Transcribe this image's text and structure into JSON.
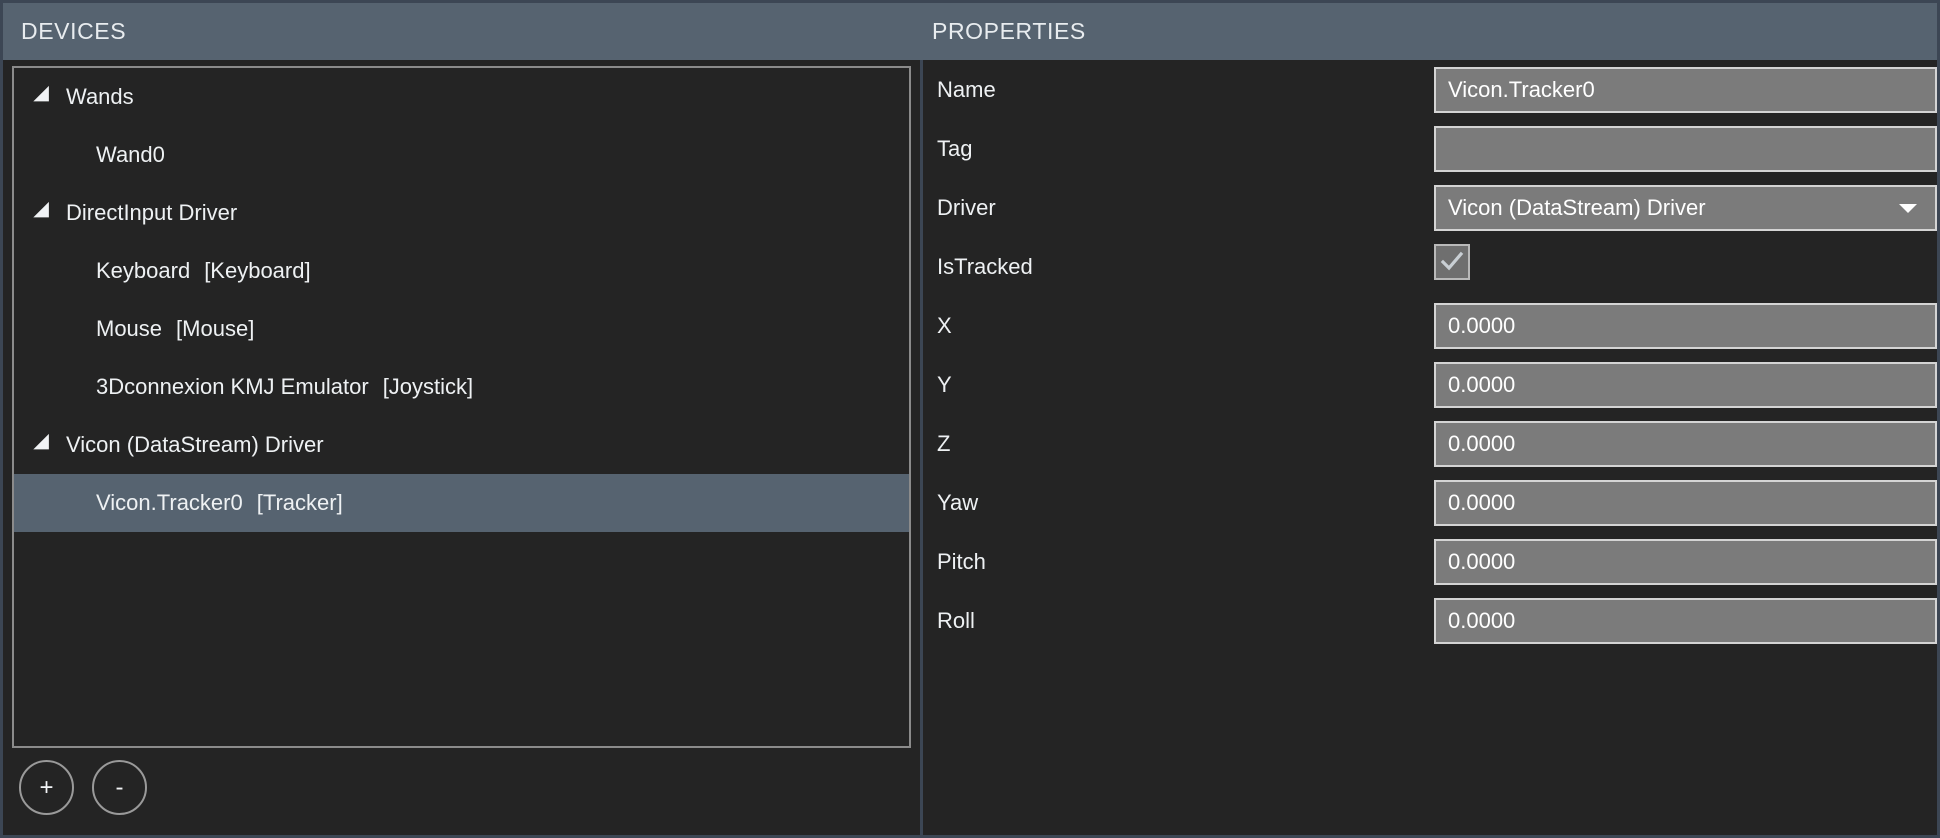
{
  "panels": {
    "devices": {
      "title": "DEVICES"
    },
    "properties": {
      "title": "PROPERTIES"
    }
  },
  "colors": {
    "accent": "#566370",
    "panel_background": "#242424",
    "field_background": "#7b7b7b",
    "border": "#8b8b8b",
    "outer_border": "#3c4654",
    "text": "#eef1f3"
  },
  "devices": {
    "tree": [
      {
        "depth": 0,
        "twisty": true,
        "label": "Wands",
        "type": "",
        "selected": false
      },
      {
        "depth": 1,
        "twisty": false,
        "label": "Wand0",
        "type": "",
        "selected": false
      },
      {
        "depth": 0,
        "twisty": true,
        "label": "DirectInput Driver",
        "type": "",
        "selected": false
      },
      {
        "depth": 1,
        "twisty": false,
        "label": "Keyboard",
        "type": "[Keyboard]",
        "selected": false
      },
      {
        "depth": 1,
        "twisty": false,
        "label": "Mouse",
        "type": "[Mouse]",
        "selected": false
      },
      {
        "depth": 1,
        "twisty": false,
        "label": "3Dconnexion KMJ Emulator",
        "type": "[Joystick]",
        "selected": false
      },
      {
        "depth": 0,
        "twisty": true,
        "label": "Vicon (DataStream) Driver",
        "type": "",
        "selected": false
      },
      {
        "depth": 1,
        "twisty": false,
        "label": "Vicon.Tracker0",
        "type": "[Tracker]",
        "selected": true
      }
    ],
    "add_button_label": "+",
    "remove_button_label": "-"
  },
  "properties": {
    "rows": [
      {
        "label": "Name",
        "control": "text",
        "value": "Vicon.Tracker0",
        "placeholder": ""
      },
      {
        "label": "Tag",
        "control": "text",
        "value": "",
        "placeholder": ""
      },
      {
        "label": "Driver",
        "control": "combo",
        "value": "Vicon (DataStream) Driver",
        "placeholder": ""
      },
      {
        "label": "IsTracked",
        "control": "checkbox",
        "value": "checked",
        "placeholder": ""
      },
      {
        "label": "X",
        "control": "text",
        "value": "0.0000",
        "placeholder": ""
      },
      {
        "label": "Y",
        "control": "text",
        "value": "0.0000",
        "placeholder": ""
      },
      {
        "label": "Z",
        "control": "text",
        "value": "0.0000",
        "placeholder": ""
      },
      {
        "label": "Yaw",
        "control": "text",
        "value": "0.0000",
        "placeholder": ""
      },
      {
        "label": "Pitch",
        "control": "text",
        "value": "0.0000",
        "placeholder": ""
      },
      {
        "label": "Roll",
        "control": "text",
        "value": "0.0000",
        "placeholder": ""
      }
    ],
    "driver_options": [
      "Vicon (DataStream) Driver"
    ]
  }
}
